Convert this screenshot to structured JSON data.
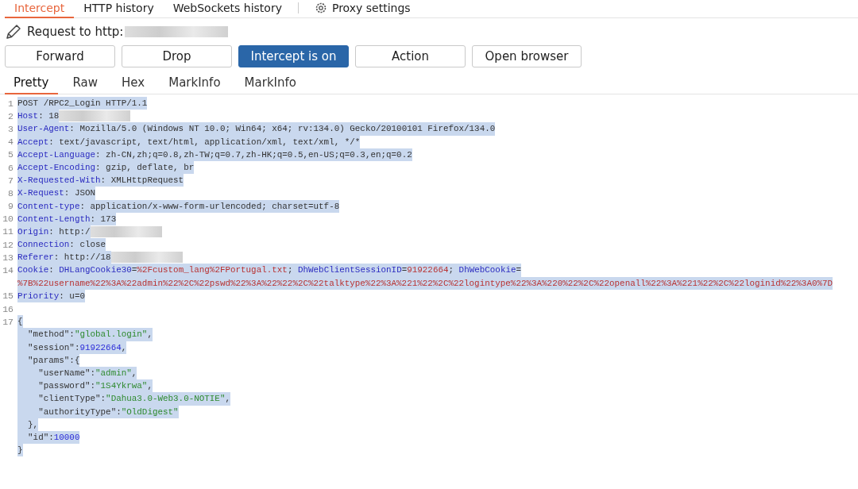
{
  "proxy_tabs": [
    {
      "label": "Intercept",
      "selected": true,
      "kind": "plain"
    },
    {
      "label": "HTTP history",
      "selected": false,
      "kind": "plain"
    },
    {
      "label": "WebSockets history",
      "selected": false,
      "kind": "plain"
    },
    {
      "label": "Proxy settings",
      "selected": false,
      "kind": "settings"
    }
  ],
  "request_label": "Request to http:",
  "buttons": [
    {
      "label": "Forward",
      "selected": false
    },
    {
      "label": "Drop",
      "selected": false
    },
    {
      "label": "Intercept is on",
      "selected": true
    },
    {
      "label": "Action",
      "selected": false
    },
    {
      "label": "Open browser",
      "selected": false
    }
  ],
  "editor_tabs": [
    {
      "label": "Pretty",
      "selected": true
    },
    {
      "label": "Raw",
      "selected": false
    },
    {
      "label": "Hex",
      "selected": false
    },
    {
      "label": "MarkInfo",
      "selected": false
    },
    {
      "label": "MarkInfo",
      "selected": false
    }
  ],
  "lines": [
    {
      "number": "1",
      "rows": [
        {
          "tokens": [
            {
              "kind": "text",
              "text": "POST /RPC2_Login HTTP/1.1"
            }
          ]
        }
      ]
    },
    {
      "number": "2",
      "rows": [
        {
          "tokens": [
            {
              "kind": "name",
              "text": "Host"
            },
            {
              "kind": "text",
              "text": ": 18"
            },
            {
              "kind": "redacted"
            }
          ]
        }
      ]
    },
    {
      "number": "3",
      "rows": [
        {
          "tokens": [
            {
              "kind": "name",
              "text": "User-Agent"
            },
            {
              "kind": "text",
              "text": ": Mozilla/5.0 (Windows NT 10.0; Win64; x64; rv:134.0) Gecko/20100101 Firefox/134.0"
            }
          ]
        }
      ]
    },
    {
      "number": "4",
      "rows": [
        {
          "tokens": [
            {
              "kind": "name",
              "text": "Accept"
            },
            {
              "kind": "text",
              "text": ": text/javascript, text/html, application/xml, text/xml, */*"
            }
          ]
        }
      ]
    },
    {
      "number": "5",
      "rows": [
        {
          "tokens": [
            {
              "kind": "name",
              "text": "Accept-Language"
            },
            {
              "kind": "text",
              "text": ": zh-CN,zh;q=0.8,zh-TW;q=0.7,zh-HK;q=0.5,en-US;q=0.3,en;q=0.2"
            }
          ]
        }
      ]
    },
    {
      "number": "6",
      "rows": [
        {
          "tokens": [
            {
              "kind": "name",
              "text": "Accept-Encoding"
            },
            {
              "kind": "text",
              "text": ": gzip, deflate, br"
            }
          ]
        }
      ]
    },
    {
      "number": "7",
      "rows": [
        {
          "tokens": [
            {
              "kind": "name",
              "text": "X-Requested-With"
            },
            {
              "kind": "text",
              "text": ": XMLHttpRequest"
            }
          ]
        }
      ]
    },
    {
      "number": "8",
      "rows": [
        {
          "tokens": [
            {
              "kind": "name",
              "text": "X-Request"
            },
            {
              "kind": "text",
              "text": ": JSON"
            }
          ]
        }
      ]
    },
    {
      "number": "9",
      "rows": [
        {
          "tokens": [
            {
              "kind": "name",
              "text": "Content-type"
            },
            {
              "kind": "text",
              "text": ": application/x-www-form-urlencoded; charset=utf-8"
            }
          ]
        }
      ]
    },
    {
      "number": "10",
      "rows": [
        {
          "tokens": [
            {
              "kind": "name",
              "text": "Content-Length"
            },
            {
              "kind": "text",
              "text": ": 173"
            }
          ]
        }
      ]
    },
    {
      "number": "11",
      "rows": [
        {
          "tokens": [
            {
              "kind": "name",
              "text": "Origin"
            },
            {
              "kind": "text",
              "text": ": http:/"
            },
            {
              "kind": "redacted"
            }
          ]
        }
      ]
    },
    {
      "number": "12",
      "rows": [
        {
          "tokens": [
            {
              "kind": "name",
              "text": "Connection"
            },
            {
              "kind": "text",
              "text": ": close"
            }
          ]
        }
      ]
    },
    {
      "number": "13",
      "rows": [
        {
          "tokens": [
            {
              "kind": "name",
              "text": "Referer"
            },
            {
              "kind": "text",
              "text": ": http://18"
            },
            {
              "kind": "redacted"
            }
          ]
        }
      ]
    },
    {
      "number": "14",
      "rows": [
        {
          "tokens": [
            {
              "kind": "name",
              "text": "Cookie"
            },
            {
              "kind": "text",
              "text": ": "
            },
            {
              "kind": "name",
              "text": "DHLangCookie30"
            },
            {
              "kind": "text",
              "text": "="
            },
            {
              "kind": "value",
              "text": "%2Fcustom_lang%2FPortugal.txt"
            },
            {
              "kind": "text",
              "text": "; "
            },
            {
              "kind": "name",
              "text": "DhWebClientSessionID"
            },
            {
              "kind": "text",
              "text": "="
            },
            {
              "kind": "value",
              "text": "91922664"
            },
            {
              "kind": "text",
              "text": "; "
            },
            {
              "kind": "name",
              "text": "DhWebCookie"
            },
            {
              "kind": "text",
              "text": "="
            }
          ]
        },
        {
          "tokens": [
            {
              "kind": "value",
              "text": "%7B%22username%22%3A%22admin%22%2C%22pswd%22%3A%22%22%2C%22talktype%22%3A%221%22%2C%22logintype%22%3A%220%22%2C%22openall%22%3A%221%22%2C%22loginid%22%3A0%7D"
            }
          ]
        }
      ]
    },
    {
      "number": "15",
      "rows": [
        {
          "tokens": [
            {
              "kind": "name",
              "text": "Priority"
            },
            {
              "kind": "text",
              "text": ": u=0"
            }
          ]
        }
      ]
    },
    {
      "number": "16",
      "rows": [
        {
          "tokens": []
        }
      ]
    },
    {
      "number": "17",
      "rows": [
        {
          "tokens": [
            {
              "kind": "text",
              "text": "{"
            }
          ]
        },
        {
          "tokens": [
            {
              "kind": "text",
              "text": "  \"method\":"
            },
            {
              "kind": "string",
              "text": "\"global.login\""
            },
            {
              "kind": "text",
              "text": ","
            }
          ]
        },
        {
          "tokens": [
            {
              "kind": "text",
              "text": "  \"session\":"
            },
            {
              "kind": "number",
              "text": "91922664"
            },
            {
              "kind": "text",
              "text": ","
            }
          ]
        },
        {
          "tokens": [
            {
              "kind": "text",
              "text": "  \"params\":{"
            }
          ]
        },
        {
          "tokens": [
            {
              "kind": "text",
              "text": "    \"userName\":"
            },
            {
              "kind": "string",
              "text": "\"admin\""
            },
            {
              "kind": "text",
              "text": ","
            }
          ]
        },
        {
          "tokens": [
            {
              "kind": "text",
              "text": "    \"password\":"
            },
            {
              "kind": "string",
              "text": "\"1S4Ykrwa\""
            },
            {
              "kind": "text",
              "text": ","
            }
          ]
        },
        {
          "tokens": [
            {
              "kind": "text",
              "text": "    \"clientType\":"
            },
            {
              "kind": "string",
              "text": "\"Dahua3.0-Web3.0-NOTIE\""
            },
            {
              "kind": "text",
              "text": ","
            }
          ]
        },
        {
          "tokens": [
            {
              "kind": "text",
              "text": "    \"authorityType\":"
            },
            {
              "kind": "string",
              "text": "\"OldDigest\""
            }
          ]
        },
        {
          "tokens": [
            {
              "kind": "text",
              "text": "  },"
            }
          ]
        },
        {
          "tokens": [
            {
              "kind": "text",
              "text": "  \"id\":"
            },
            {
              "kind": "number",
              "text": "10000"
            }
          ]
        },
        {
          "tokens": [
            {
              "kind": "text",
              "text": "}"
            }
          ]
        }
      ]
    }
  ]
}
